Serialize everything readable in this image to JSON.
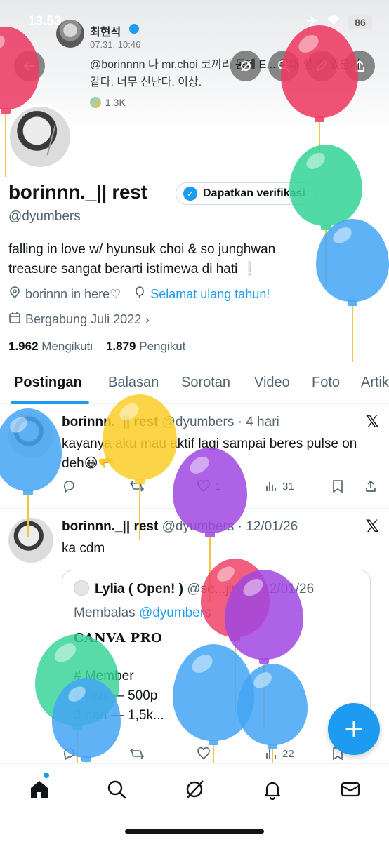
{
  "status": {
    "time": "13.53",
    "battery": "86"
  },
  "banner_tweet": {
    "author": "최현석",
    "date": "07.31. 10:46",
    "text": "@borinnnn 나 mr.choi 코끼리 동에 E... 무대 할 수 있을거같다. 너무 신난다. 이상.",
    "likes": "1.3K"
  },
  "profile": {
    "display_name": "borinnn._|| rest",
    "verify_button": "Dapatkan verifikasi",
    "handle": "@dyumbers",
    "bio_line1": "falling in love w/ hyunsuk choi & so junghwan",
    "bio_line2": "treasure sangat berarti istimewa di hati ❕",
    "location": "borinnn in here♡",
    "birthday_link": "Selamat ulang tahun!",
    "joined": "Bergabung Juli 2022",
    "following_count": "1.962",
    "following_label": "Mengikuti",
    "followers_count": "1.879",
    "followers_label": "Pengikut"
  },
  "tabs": [
    "Postingan",
    "Balasan",
    "Sorotan",
    "Video",
    "Foto",
    "Artikel"
  ],
  "posts": [
    {
      "name": "borinnn._|| rest",
      "handle": "@dyumbers",
      "time": "· 4 hari",
      "text": "kayanya aku mau aktif lagi sampai beres pulse on deh😀🫳",
      "likes": "1",
      "views": "31"
    },
    {
      "name": "borinnn._|| rest",
      "handle": "@dyumbers",
      "time": "· 12/01/26",
      "text": "ka cdm",
      "views": "22",
      "quote": {
        "name": "Lylia ( Open! )",
        "handle": "@se...jin...",
        "time": "· 12/01/26",
        "reply_prefix": "Membalas",
        "reply_to": "@dyumbers",
        "title": "CANVA PRO",
        "line1": "# Member",
        "line2": "1 hari — 500p",
        "line3": "3 hari — 1,5k..."
      }
    }
  ],
  "icons": {
    "back": "arrow-left-icon",
    "grok": "grok-icon",
    "search": "search-icon",
    "edit": "pencil-icon",
    "share": "share-icon",
    "fab": "plus-icon",
    "nav": [
      "home-icon",
      "search-icon",
      "grok-icon",
      "bell-icon",
      "mail-icon"
    ]
  },
  "colors": {
    "accent": "#1d9bf0",
    "text": "#0f1419",
    "muted": "#536471"
  }
}
